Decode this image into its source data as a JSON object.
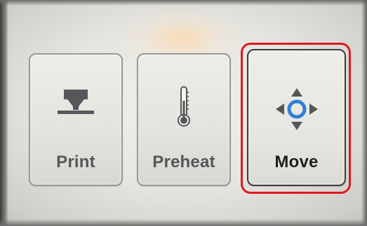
{
  "menu": {
    "tiles": [
      {
        "label": "Print",
        "icon": "print-head-icon",
        "selected": false
      },
      {
        "label": "Preheat",
        "icon": "thermometer-icon",
        "selected": false
      },
      {
        "label": "Move",
        "icon": "move-arrows-icon",
        "selected": true
      }
    ]
  },
  "colors": {
    "screen_background": "#e6e5e1",
    "tile_background": "#e4e3de",
    "tile_border": "#9a9994",
    "label_color": "#56575a",
    "selected_label_color": "#1f1f20",
    "selection_highlight": "#e01820",
    "move_icon_accent": "#2f7fd8",
    "icon_dark": "#545559"
  }
}
